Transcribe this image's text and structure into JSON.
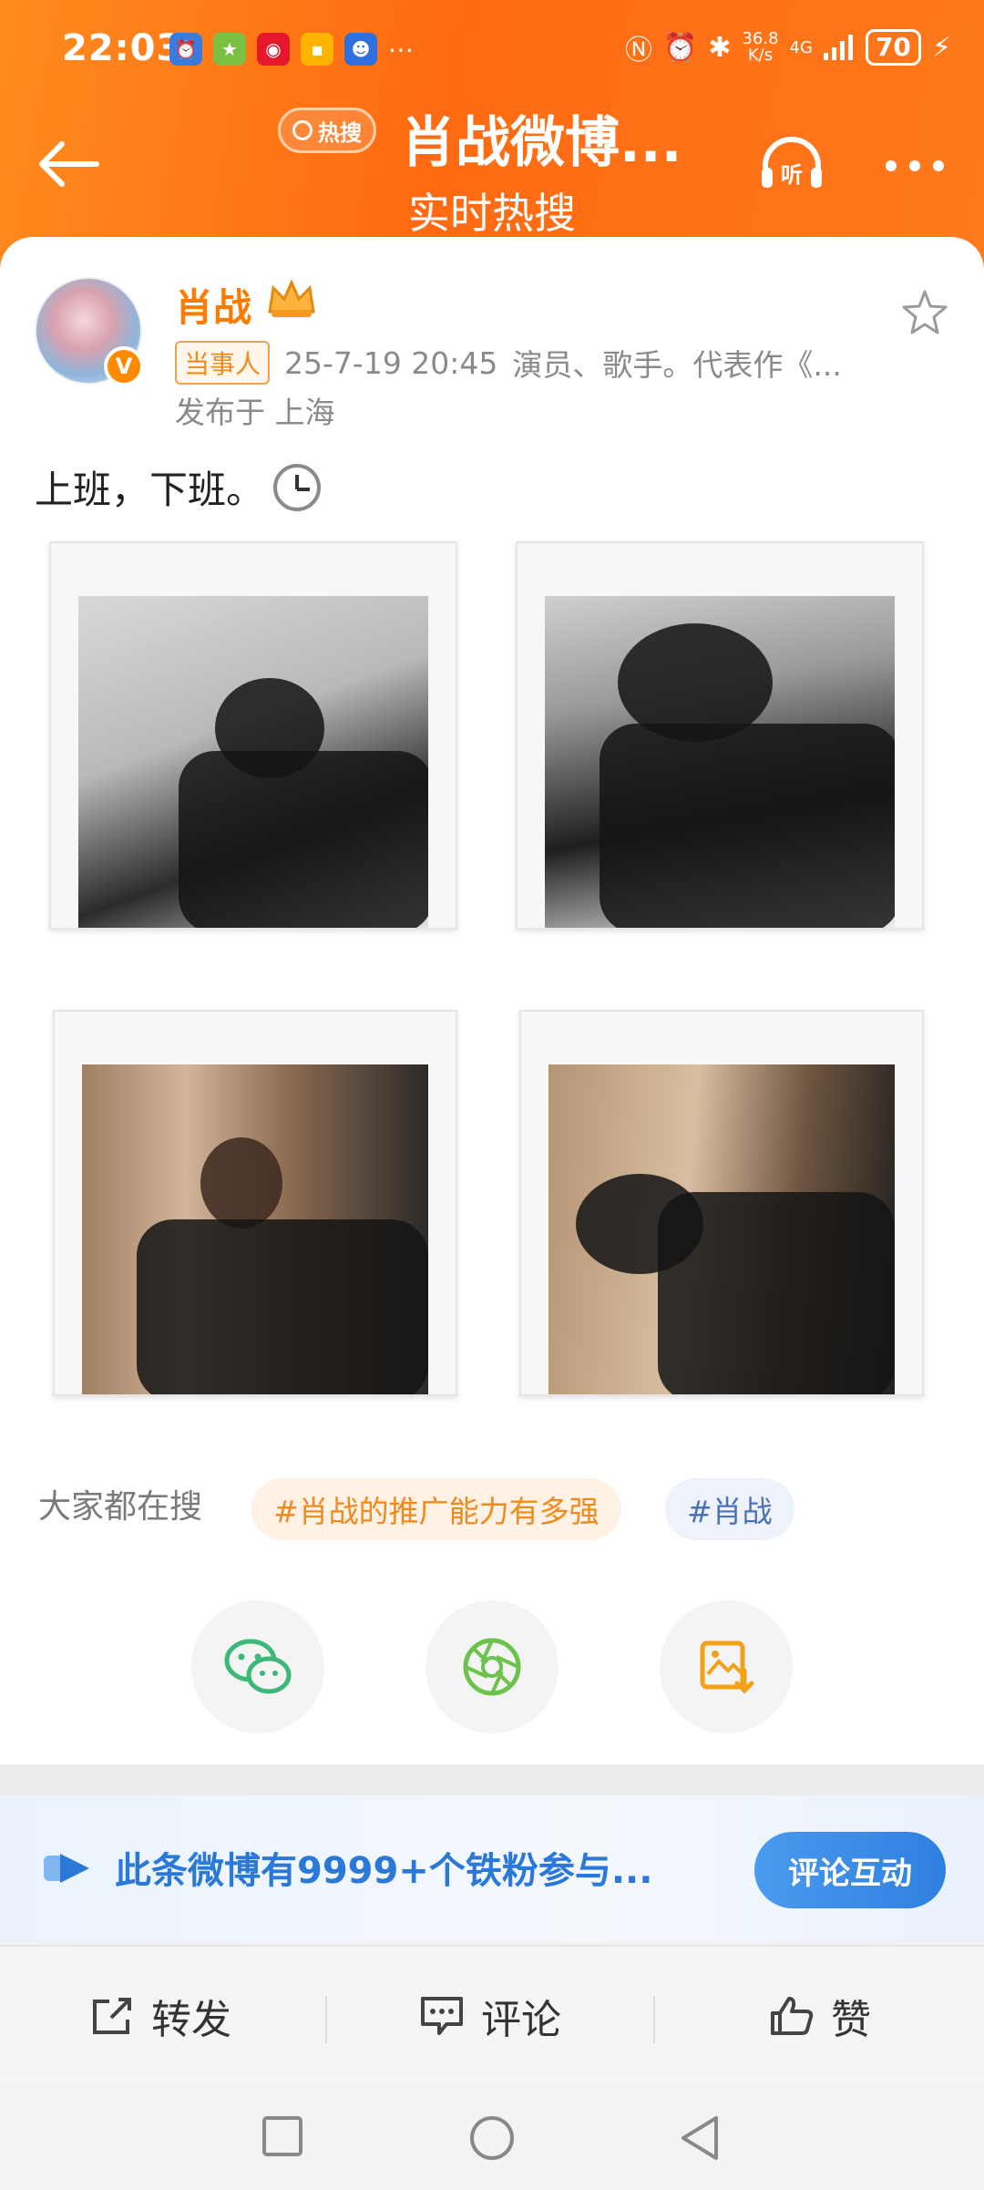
{
  "status_bar": {
    "time": "22:03",
    "network_speed_value": "36.8",
    "network_speed_unit": "K/s",
    "signal": "4G",
    "battery": "70"
  },
  "header": {
    "hot_badge": "热搜",
    "title": "肖战微博...",
    "subtitle": "实时热搜",
    "listen_label": "听"
  },
  "post": {
    "username": "肖战",
    "role_badge": "当事人",
    "timestamp": "25-7-19 20:45",
    "bio": "演员、歌手。代表作《...",
    "location": "发布于 上海",
    "text": "上班，下班。",
    "verified_mark": "V"
  },
  "search": {
    "label": "大家都在搜",
    "tags": [
      "#肖战的推广能力有多强",
      "#肖战"
    ]
  },
  "fans_bar": {
    "text": "此条微博有9999+个铁粉参与...",
    "button": "评论互动"
  },
  "actions": {
    "repost": "转发",
    "comment": "评论",
    "like": "赞"
  },
  "colors": {
    "brand_orange": "#ff6a12",
    "username_orange": "#ff7b00",
    "link_blue": "#2a78d8"
  }
}
